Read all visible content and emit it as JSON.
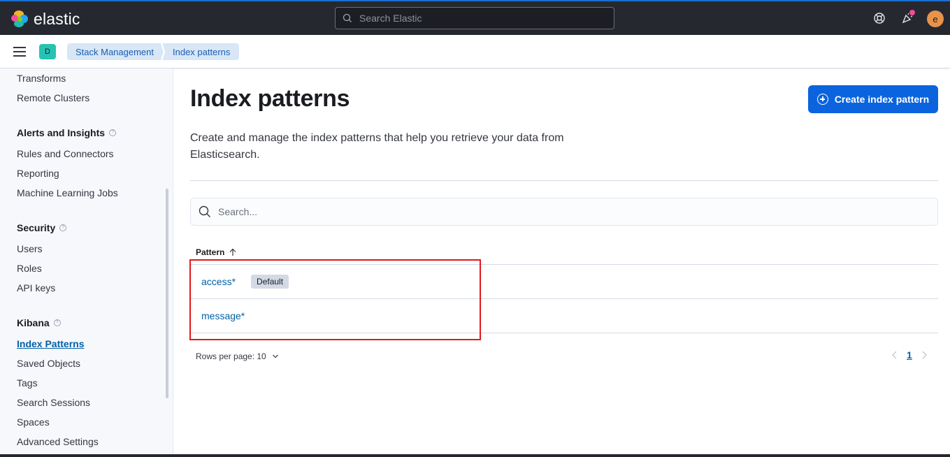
{
  "app": {
    "logo_text": "elastic",
    "search_placeholder": "Search Elastic",
    "avatar_initial": "e",
    "space_initial": "D"
  },
  "breadcrumbs": [
    "Stack Management",
    "Index patterns"
  ],
  "sidebar": {
    "top_items": [
      "Transforms",
      "Remote Clusters"
    ],
    "groups": [
      {
        "title": "Alerts and Insights",
        "items": [
          "Rules and Connectors",
          "Reporting",
          "Machine Learning Jobs"
        ]
      },
      {
        "title": "Security",
        "items": [
          "Users",
          "Roles",
          "API keys"
        ]
      },
      {
        "title": "Kibana",
        "items": [
          "Index Patterns",
          "Saved Objects",
          "Tags",
          "Search Sessions",
          "Spaces",
          "Advanced Settings"
        ]
      }
    ],
    "active_item": "Index Patterns"
  },
  "main": {
    "title": "Index patterns",
    "create_button": "Create index pattern",
    "description": "Create and manage the index patterns that help you retrieve your data from Elasticsearch.",
    "search_placeholder": "Search...",
    "column_header": "Pattern",
    "rows": [
      {
        "pattern": "access*",
        "badge": "Default"
      },
      {
        "pattern": "message*",
        "badge": ""
      }
    ],
    "rows_per_page": "Rows per page: 10",
    "current_page": "1"
  },
  "colors": {
    "header_bg": "#25282f",
    "accent": "#0b64dd",
    "link": "#0061a6",
    "highlight_box": "#e0191b"
  }
}
